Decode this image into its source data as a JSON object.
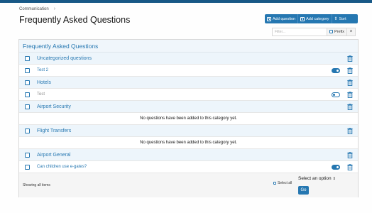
{
  "breadcrumb": {
    "items": [
      "Communication"
    ]
  },
  "page": {
    "title": "Frequently Asked Questions"
  },
  "toolbar": {
    "add_question": "Add question",
    "add_category": "Add category",
    "sort": "Sort"
  },
  "filter": {
    "placeholder": "Filter...",
    "prefix_label": "Prefix",
    "clear": "×"
  },
  "list": {
    "header": "Frequently Asked Questions",
    "rows": [
      {
        "type": "category",
        "label": "Uncategorized questions"
      },
      {
        "type": "question",
        "label": "Test 2",
        "enabled": true
      },
      {
        "type": "category",
        "label": "Hotels"
      },
      {
        "type": "question",
        "label": "Test",
        "enabled": false
      },
      {
        "type": "category",
        "label": "Airport Security"
      },
      {
        "type": "message",
        "label": "No questions have been added to this category yet."
      },
      {
        "type": "category",
        "label": "Flight Transfers"
      },
      {
        "type": "message",
        "label": "No questions have been added to this category yet."
      },
      {
        "type": "category",
        "label": "Airport General"
      },
      {
        "type": "question",
        "label": "Can children use e-gates?",
        "enabled": true
      }
    ]
  },
  "footer": {
    "showing": "Showing all items",
    "select_all": "Select all",
    "select_placeholder": "Select an option",
    "go": "Go"
  },
  "colors": {
    "accent": "#2577b1",
    "category_bg": "#edf5fb",
    "topbar": "#185886"
  }
}
